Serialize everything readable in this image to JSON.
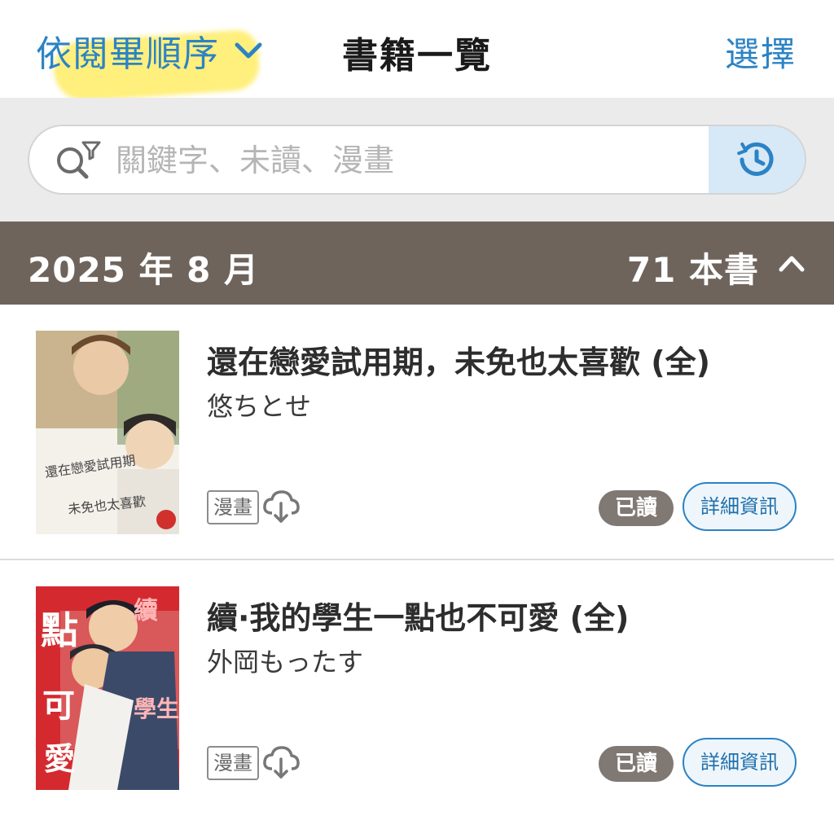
{
  "header": {
    "sort_label": "依閱畢順序",
    "sort_icon": "chevron-down-icon",
    "title": "書籍一覽",
    "select_label": "選擇"
  },
  "search": {
    "placeholder": "關鍵字、未讀、漫畫",
    "search_icon": "search-filter-icon",
    "history_icon": "history-icon"
  },
  "month_group": {
    "label": "2025 年 8 月",
    "count": "71 本書",
    "collapse_icon": "chevron-up-icon"
  },
  "books": [
    {
      "title": "還在戀愛試用期，未免也太喜歡 (全)",
      "author": "悠ちとせ",
      "tag": "漫畫",
      "status": "已讀",
      "detail": "詳細資訊"
    },
    {
      "title": "續·我的學生一點也不可愛 (全)",
      "author": "外岡もったす",
      "tag": "漫畫",
      "status": "已讀",
      "detail": "詳細資訊"
    }
  ],
  "colors": {
    "accent": "#2b83c5",
    "month_bar": "#6f645c",
    "read_badge": "#807873",
    "highlight": "#ffea50"
  }
}
